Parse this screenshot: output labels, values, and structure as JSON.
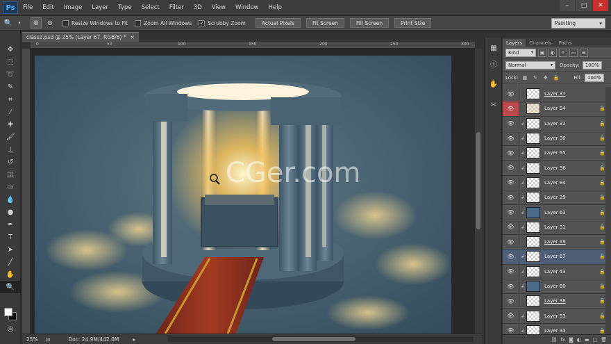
{
  "app": {
    "logo": "Ps",
    "menu": [
      "File",
      "Edit",
      "Image",
      "Layer",
      "Type",
      "Select",
      "Filter",
      "3D",
      "View",
      "Window",
      "Help"
    ],
    "window_controls": [
      "–",
      "□",
      "✕"
    ]
  },
  "options_bar": {
    "resize_windows": "Resize Windows to Fit",
    "zoom_all": "Zoom All Windows",
    "scrubby": "Scrubby Zoom",
    "scrubby_checked": "✓",
    "actual_pixels": "Actual Pixels",
    "fit_screen": "Fit Screen",
    "fill_screen": "Fill Screen",
    "print_size": "Print Size",
    "workspace": "Painting"
  },
  "document": {
    "tab_title": "class2.psd @ 25% (Layer 67, RGB/8) *",
    "close": "×",
    "ruler_ticks": [
      "0",
      "50",
      "100",
      "150",
      "200",
      "250",
      "300"
    ],
    "watermark": "CGer.com"
  },
  "status": {
    "zoom": "25%",
    "doc_info": "Doc: 24.9M/442.0M"
  },
  "layers_panel": {
    "tabs": [
      "Layers",
      "Channels",
      "Paths"
    ],
    "filter_kind": "Kind",
    "blend_mode": "Normal",
    "opacity_label": "Opacity:",
    "opacity_value": "100%",
    "lock_label": "Lock:",
    "fill_label": "Fill:",
    "fill_value": "100%",
    "layers": [
      {
        "name": "Layer 37",
        "group_style": true,
        "thumb": "checker",
        "clip": false,
        "lock": false,
        "eye_red": false,
        "selected": false
      },
      {
        "name": "Layer 54",
        "group_style": false,
        "thumb": "warm",
        "clip": false,
        "lock": true,
        "eye_red": true,
        "selected": false
      },
      {
        "name": "Layer 32",
        "group_style": false,
        "thumb": "checker",
        "clip": true,
        "lock": true,
        "eye_red": false,
        "selected": false
      },
      {
        "name": "Layer 30",
        "group_style": false,
        "thumb": "checker",
        "clip": true,
        "lock": true,
        "eye_red": false,
        "selected": false
      },
      {
        "name": "Layer 55",
        "group_style": false,
        "thumb": "checker",
        "clip": true,
        "lock": true,
        "eye_red": false,
        "selected": false
      },
      {
        "name": "Layer 36",
        "group_style": false,
        "thumb": "checker",
        "clip": true,
        "lock": true,
        "eye_red": false,
        "selected": false
      },
      {
        "name": "Layer 64",
        "group_style": false,
        "thumb": "checker",
        "clip": true,
        "lock": true,
        "eye_red": false,
        "selected": false
      },
      {
        "name": "Layer 29",
        "group_style": false,
        "thumb": "checker",
        "clip": true,
        "lock": true,
        "eye_red": false,
        "selected": false
      },
      {
        "name": "Layer 63",
        "group_style": false,
        "thumb": "solid",
        "clip": true,
        "lock": true,
        "eye_red": false,
        "selected": false
      },
      {
        "name": "Layer 31",
        "group_style": false,
        "thumb": "checker",
        "clip": true,
        "lock": true,
        "eye_red": false,
        "selected": false
      },
      {
        "name": "Layer 19",
        "group_style": true,
        "thumb": "checker",
        "clip": false,
        "lock": true,
        "eye_red": false,
        "selected": false
      },
      {
        "name": "Layer 67",
        "group_style": false,
        "thumb": "checker",
        "clip": true,
        "lock": true,
        "eye_red": false,
        "selected": true
      },
      {
        "name": "Layer 43",
        "group_style": false,
        "thumb": "checker",
        "clip": true,
        "lock": true,
        "eye_red": false,
        "selected": false
      },
      {
        "name": "Layer 60",
        "group_style": false,
        "thumb": "solid",
        "clip": true,
        "lock": true,
        "eye_red": false,
        "selected": false
      },
      {
        "name": "Layer 38",
        "group_style": true,
        "thumb": "checker",
        "clip": false,
        "lock": true,
        "eye_red": false,
        "selected": false
      },
      {
        "name": "Layer 53",
        "group_style": false,
        "thumb": "checker",
        "clip": true,
        "lock": true,
        "eye_red": false,
        "selected": false
      },
      {
        "name": "Layer 33",
        "group_style": false,
        "thumb": "checker",
        "clip": true,
        "lock": true,
        "eye_red": false,
        "selected": false
      }
    ],
    "footer_icons": [
      "link-icon",
      "fx-icon",
      "mask-icon",
      "adjustment-icon",
      "folder-icon",
      "new-layer-icon",
      "trash-icon"
    ]
  },
  "colors": {
    "accent": "#4e5e76",
    "red_eye": "#b84a4a",
    "canvas_bg": "#3f5b6c"
  }
}
